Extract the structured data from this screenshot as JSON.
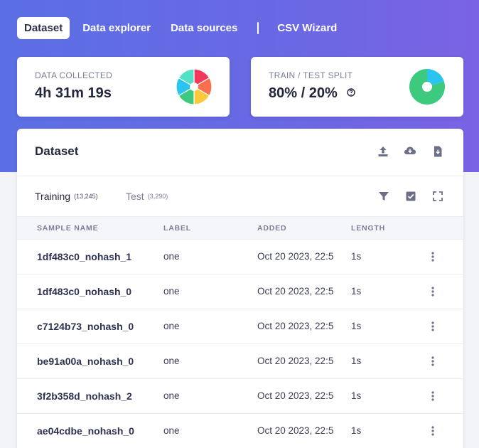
{
  "nav": {
    "tabs": [
      {
        "label": "Dataset",
        "active": true
      },
      {
        "label": "Data explorer"
      },
      {
        "label": "Data sources"
      },
      {
        "label": "CSV Wizard"
      }
    ]
  },
  "stats": {
    "collected": {
      "label": "DATA COLLECTED",
      "value": "4h 31m 19s"
    },
    "split": {
      "label": "TRAIN / TEST SPLIT",
      "value": "80% / 20%",
      "train_percent": 80,
      "test_percent": 20
    }
  },
  "colors": {
    "accent": "#5b6fe4",
    "train": "#3dca7e",
    "test": "#29c4f0",
    "pie": [
      "#f2395d",
      "#fa6f4f",
      "#fcc93a",
      "#3dca7e",
      "#29c4f0",
      "#52e0c6"
    ]
  },
  "panel": {
    "title": "Dataset",
    "icons": [
      "upload-icon",
      "cloud-download-icon",
      "export-icon"
    ],
    "filter_icons": [
      "filter-icon",
      "select-all-icon",
      "fullscreen-icon"
    ]
  },
  "subtabs": [
    {
      "label": "Training",
      "count": "(13,245)"
    },
    {
      "label": "Test",
      "count": "(3,290)"
    }
  ],
  "table": {
    "columns": [
      "SAMPLE NAME",
      "LABEL",
      "ADDED",
      "LENGTH"
    ],
    "rows": [
      {
        "name": "1df483c0_nohash_1",
        "label": "one",
        "added": "Oct 20 2023, 22:5",
        "length": "1s"
      },
      {
        "name": "1df483c0_nohash_0",
        "label": "one",
        "added": "Oct 20 2023, 22:5",
        "length": "1s"
      },
      {
        "name": "c7124b73_nohash_0",
        "label": "one",
        "added": "Oct 20 2023, 22:5",
        "length": "1s"
      },
      {
        "name": "be91a00a_nohash_0",
        "label": "one",
        "added": "Oct 20 2023, 22:5",
        "length": "1s"
      },
      {
        "name": "3f2b358d_nohash_2",
        "label": "one",
        "added": "Oct 20 2023, 22:5",
        "length": "1s"
      },
      {
        "name": "ae04cdbe_nohash_0",
        "label": "one",
        "added": "Oct 20 2023, 22:5",
        "length": "1s"
      }
    ]
  }
}
